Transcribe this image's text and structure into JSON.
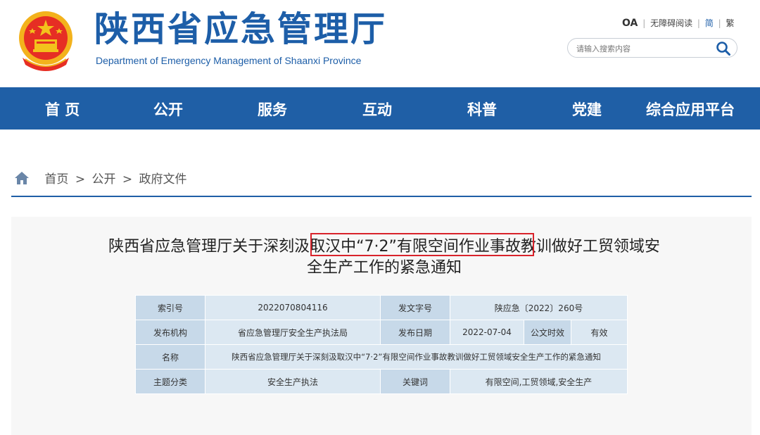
{
  "header": {
    "title": "陕西省应急管理厅",
    "subtitle": "Department of Emergency Management of Shaanxi Province",
    "emblem_icon": "national-emblem-icon",
    "links": {
      "oa": "OA",
      "accessible": "无障碍阅读",
      "simplified": "简",
      "traditional": "繁",
      "sep": "|"
    },
    "search": {
      "placeholder": "请输入搜索内容",
      "icon": "search-icon"
    }
  },
  "nav": {
    "items": [
      {
        "label": "首 页"
      },
      {
        "label": "公开"
      },
      {
        "label": "服务"
      },
      {
        "label": "互动"
      },
      {
        "label": "科普"
      },
      {
        "label": "党建"
      },
      {
        "label": "综合应用平台"
      }
    ],
    "background": "#1f5fa6"
  },
  "breadcrumb": {
    "icon": "home-icon",
    "items": [
      "首页",
      "公开",
      "政府文件"
    ],
    "sep": ">"
  },
  "document": {
    "title_line1": "陕西省应急管理厅关于深刻汲取汉中“7·2”有限空间作业事故教训做好工贸领域安",
    "title_line2": "全生产工作的紧急通知",
    "meta": {
      "index_label": "索引号",
      "index_value": "2022070804116",
      "docno_label": "发文字号",
      "docno_value": "陕应急〔2022〕260号",
      "publisher_label": "发布机构",
      "publisher_value": "省应急管理厅安全生产执法局",
      "date_label": "发布日期",
      "date_value": "2022-07-04",
      "validity_label": "公文时效",
      "validity_value": "有效",
      "name_label": "名称",
      "name_value": "陕西省应急管理厅关于深刻汲取汉中“7·2”有限空间作业事故教训做好工贸领域安全生产工作的紧急通知",
      "topic_label": "主题分类",
      "topic_value": "安全生产执法",
      "keyword_label": "关键词",
      "keyword_value": "有限空间,工贸领域,安全生产"
    }
  },
  "colors": {
    "brand": "#1d5ea8",
    "highlight": "#d9232b",
    "table_label": "#c7d9e9",
    "table_value": "#dce8f2"
  }
}
